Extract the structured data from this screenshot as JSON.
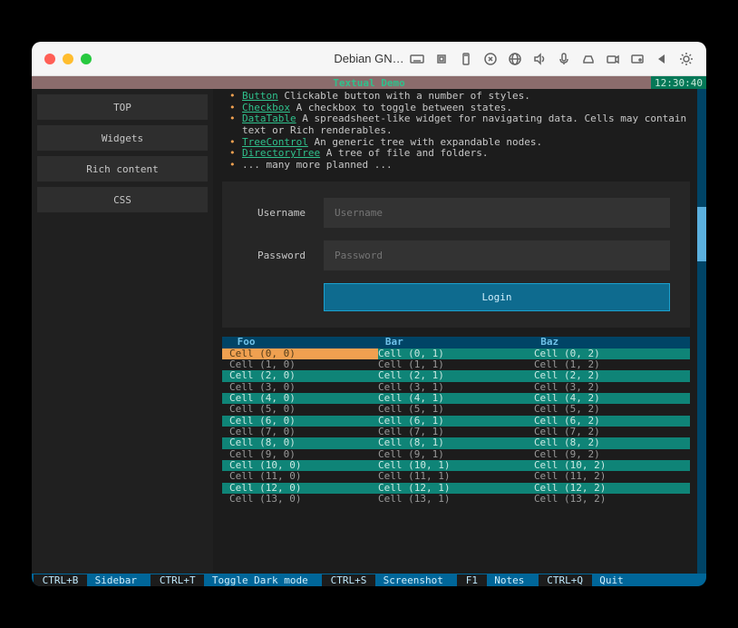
{
  "window": {
    "title": "Debian GN…"
  },
  "header": {
    "title": "Textual Demo",
    "clock": "12:30:40"
  },
  "sidebar": {
    "items": [
      {
        "label": "TOP"
      },
      {
        "label": "Widgets"
      },
      {
        "label": "Rich content"
      },
      {
        "label": "CSS"
      }
    ]
  },
  "bullets": [
    {
      "name": "Button",
      "desc": " Clickable button with a number of styles."
    },
    {
      "name": "Checkbox",
      "desc": " A checkbox to toggle between states."
    },
    {
      "name": "DataTable",
      "desc": " A spreadsheet-like widget for navigating data. Cells may contain text or Rich renderables."
    },
    {
      "name": "TreeControl",
      "desc": " An generic tree with expandable nodes."
    },
    {
      "name": "DirectoryTree",
      "desc": " A tree of file and folders."
    },
    {
      "name": "",
      "desc": "... many more planned ..."
    }
  ],
  "form": {
    "username_label": "Username",
    "username_placeholder": "Username",
    "password_label": "Password",
    "password_placeholder": "Password",
    "login_label": "Login"
  },
  "table": {
    "headers": [
      "Foo",
      "Bar",
      "Baz"
    ],
    "rows": [
      [
        "Cell (0, 0)",
        "Cell (0, 1)",
        "Cell (0, 2)"
      ],
      [
        "Cell (1, 0)",
        "Cell (1, 1)",
        "Cell (1, 2)"
      ],
      [
        "Cell (2, 0)",
        "Cell (2, 1)",
        "Cell (2, 2)"
      ],
      [
        "Cell (3, 0)",
        "Cell (3, 1)",
        "Cell (3, 2)"
      ],
      [
        "Cell (4, 0)",
        "Cell (4, 1)",
        "Cell (4, 2)"
      ],
      [
        "Cell (5, 0)",
        "Cell (5, 1)",
        "Cell (5, 2)"
      ],
      [
        "Cell (6, 0)",
        "Cell (6, 1)",
        "Cell (6, 2)"
      ],
      [
        "Cell (7, 0)",
        "Cell (7, 1)",
        "Cell (7, 2)"
      ],
      [
        "Cell (8, 0)",
        "Cell (8, 1)",
        "Cell (8, 2)"
      ],
      [
        "Cell (9, 0)",
        "Cell (9, 1)",
        "Cell (9, 2)"
      ],
      [
        "Cell (10, 0)",
        "Cell (10, 1)",
        "Cell (10, 2)"
      ],
      [
        "Cell (11, 0)",
        "Cell (11, 1)",
        "Cell (11, 2)"
      ],
      [
        "Cell (12, 0)",
        "Cell (12, 1)",
        "Cell (12, 2)"
      ],
      [
        "Cell (13, 0)",
        "Cell (13, 1)",
        "Cell (13, 2)"
      ]
    ],
    "selected_row": 0
  },
  "footer": [
    {
      "key": "CTRL+B",
      "label": "Sidebar"
    },
    {
      "key": "CTRL+T",
      "label": "Toggle Dark mode"
    },
    {
      "key": "CTRL+S",
      "label": "Screenshot"
    },
    {
      "key": "F1",
      "label": "Notes"
    },
    {
      "key": "CTRL+Q",
      "label": "Quit"
    }
  ]
}
